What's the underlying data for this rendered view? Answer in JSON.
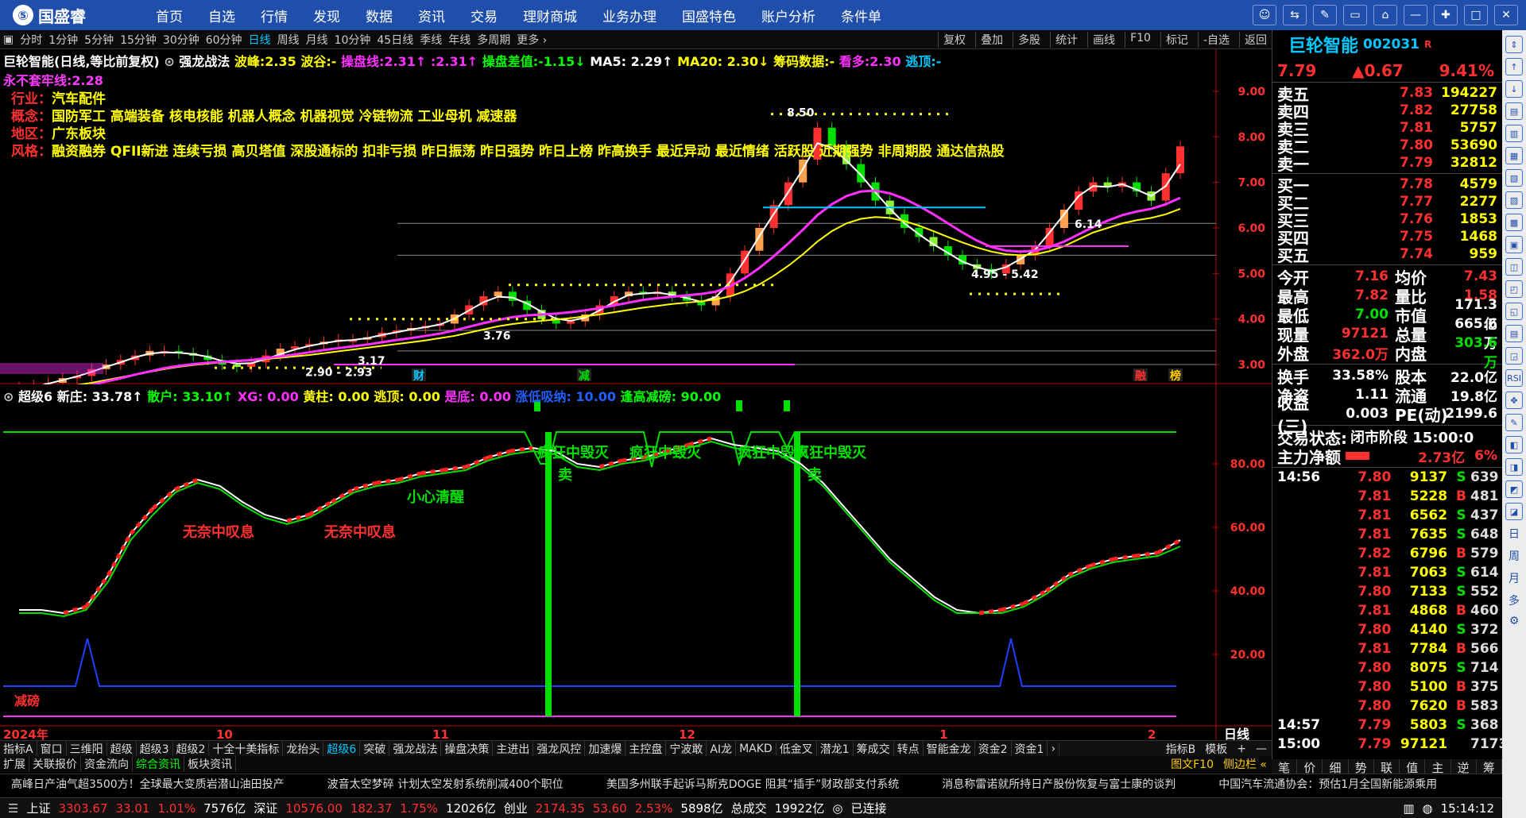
{
  "app": {
    "logo_glyph": "⑤",
    "name": "国盛睿",
    "nav": [
      "首页",
      "自选",
      "行情",
      "发现",
      "数据",
      "资讯",
      "交易",
      "理财商城",
      "业务办理",
      "国盛特色",
      "账户分析",
      "条件单"
    ],
    "window_controls": [
      "☺",
      "⇆",
      "✎",
      "▭",
      "⌂",
      "—",
      "✚",
      "□",
      "✕"
    ]
  },
  "periods": [
    "分时",
    "1分钟",
    "5分钟",
    "15分钟",
    "30分钟",
    "60分钟",
    "日线",
    "周线",
    "月线",
    "10分钟",
    "45日线",
    "季线",
    "年线",
    "多周期",
    "更多 ›"
  ],
  "active_period": "日线",
  "period_right": [
    "复权",
    "叠加",
    "多股",
    "统计",
    "画线",
    "F10",
    "标记",
    "-自选",
    "返回"
  ],
  "header": {
    "stock": "巨轮智能",
    "mode": "(日线,等比前复权)",
    "strategy": "强龙战法",
    "peak": "波峰:2.35",
    "valley": "波谷:-",
    "control_line": "操盘线:2.31↑ :2.31↑",
    "control_diff": "操盘差值:-1.15↓",
    "ma5": "MA5: 2.29↑",
    "ma20": "MA20: 2.30↓",
    "chips": "筹码数据:-",
    "longshort": "看多:2.30",
    "escape": "逃顶:-",
    "line2": "永不套牢线:2.28"
  },
  "tags": [
    {
      "label": "行业：",
      "value": "汽车配件"
    },
    {
      "label": "概念：",
      "value": "国防军工 高端装备 核电核能 机器人概念 机器视觉 冷链物流 工业母机 减速器"
    },
    {
      "label": "地区：",
      "value": "广东板块"
    },
    {
      "label": "风格：",
      "value": "融资融券 QFII新进 连续亏损 高贝塔值 深股通标的 扣非亏损 昨日振荡 昨日强势 昨日上榜 昨高换手 最近异动 最近情绪 活跃股 近期强势 非周期股 通达信热股"
    }
  ],
  "main_labels": {
    "high": "8.50",
    "low_a": "2.90 - 2.93",
    "low_b": "3.17",
    "mid": "3.76",
    "range1": "4.95 - 5.42",
    "range2": "6.14",
    "event_cai": "财",
    "event_jian": "减",
    "event_rong": "融",
    "event_bang": "榜"
  },
  "sub_header": {
    "name": "超级6",
    "xinzhuang": "新庄: 33.78↑",
    "sanhu": "散户: 33.10↑",
    "xg": "XG: 0.00",
    "huangzhu": "黄柱: 0.00",
    "taoding": "逃顶: 0.00",
    "shidi": "是底: 0.00",
    "zhangdi": "涨低吸纳: 10.00",
    "fengao": "逢高减磅: 90.00"
  },
  "sub_labels": {
    "wn1": "无奈中叹息",
    "wn2": "无奈中叹息",
    "xx": "小心清醒",
    "hm1": "疯狂中毁灭",
    "hm2": "疯狂中毁灭",
    "hm3": "疯狂中毁灭",
    "hm4": "疯狂中毁灭",
    "sell1": "卖",
    "sell2": "卖",
    "jianbang": "减磅"
  },
  "chart_data": [
    {
      "type": "line",
      "title": "",
      "ylim": [
        2.6,
        9.4
      ],
      "y_ticks": [
        "9.00",
        "8.00",
        "7.00",
        "6.00",
        "5.00",
        "4.00",
        "3.00"
      ],
      "x_ticks": [
        "2024年",
        "10",
        "11",
        "12",
        "1",
        "2"
      ],
      "bottom_right_label": "日线",
      "candles_close": [
        2.5,
        2.55,
        2.6,
        2.7,
        2.75,
        2.9,
        3.0,
        3.1,
        3.2,
        3.3,
        3.3,
        3.25,
        3.2,
        3.1,
        3.0,
        2.95,
        3.05,
        3.2,
        3.35,
        3.4,
        3.45,
        3.5,
        3.55,
        3.55,
        3.6,
        3.7,
        3.75,
        3.8,
        3.85,
        3.9,
        4.1,
        4.3,
        4.5,
        4.6,
        4.4,
        4.2,
        4.0,
        3.9,
        3.95,
        4.1,
        4.3,
        4.5,
        4.6,
        4.55,
        4.6,
        4.5,
        4.4,
        4.3,
        4.5,
        5.0,
        5.5,
        6.0,
        6.5,
        7.0,
        7.5,
        8.2,
        7.8,
        7.4,
        7.0,
        6.6,
        6.3,
        6.0,
        5.8,
        5.6,
        5.4,
        5.2,
        5.1,
        5.0,
        5.2,
        5.4,
        5.6,
        6.0,
        6.4,
        6.8,
        7.0,
        6.9,
        7.0,
        6.8,
        6.6,
        7.2,
        7.79
      ],
      "series": [
        {
          "name": "MA5",
          "values": [
            2.45,
            2.5,
            2.58,
            2.66,
            2.74,
            2.84,
            2.95,
            3.05,
            3.16,
            3.24,
            3.27,
            3.26,
            3.23,
            3.17,
            3.08,
            3.02,
            3.03,
            3.12,
            3.23,
            3.33,
            3.41,
            3.47,
            3.52,
            3.54,
            3.58,
            3.65,
            3.71,
            3.77,
            3.82,
            3.88,
            4.01,
            4.19,
            4.37,
            4.49,
            4.47,
            4.34,
            4.16,
            4.01,
            3.96,
            4.03,
            4.19,
            4.38,
            4.53,
            4.56,
            4.58,
            4.53,
            4.46,
            4.38,
            4.48,
            4.82,
            5.3,
            5.82,
            6.31,
            6.79,
            7.29,
            7.86,
            7.76,
            7.48,
            7.16,
            6.78,
            6.42,
            6.1,
            5.86,
            5.64,
            5.45,
            5.26,
            5.14,
            5.05,
            5.14,
            5.32,
            5.52,
            5.9,
            6.3,
            6.7,
            6.92,
            6.9,
            6.96,
            6.84,
            6.7,
            6.92,
            7.4
          ]
        },
        {
          "name": "MA20",
          "values": [
            2.4,
            2.43,
            2.46,
            2.5,
            2.55,
            2.6,
            2.66,
            2.72,
            2.78,
            2.84,
            2.9,
            2.95,
            2.99,
            3.02,
            3.05,
            3.07,
            3.09,
            3.12,
            3.15,
            3.18,
            3.21,
            3.25,
            3.29,
            3.33,
            3.37,
            3.41,
            3.45,
            3.49,
            3.53,
            3.58,
            3.63,
            3.7,
            3.77,
            3.84,
            3.89,
            3.93,
            3.96,
            3.99,
            4.02,
            4.06,
            4.1,
            4.15,
            4.2,
            4.25,
            4.29,
            4.33,
            4.36,
            4.39,
            4.43,
            4.5,
            4.61,
            4.76,
            4.95,
            5.17,
            5.42,
            5.7,
            5.93,
            6.1,
            6.2,
            6.24,
            6.22,
            6.15,
            6.05,
            5.93,
            5.8,
            5.68,
            5.57,
            5.48,
            5.42,
            5.4,
            5.42,
            5.49,
            5.6,
            5.75,
            5.9,
            6.0,
            6.1,
            6.17,
            6.22,
            6.3,
            6.42
          ]
        },
        {
          "name": "操盘线",
          "values": [
            2.3,
            2.33,
            2.37,
            2.42,
            2.48,
            2.55,
            2.63,
            2.7,
            2.78,
            2.85,
            2.92,
            2.97,
            3.01,
            3.04,
            3.06,
            3.08,
            3.1,
            3.14,
            3.18,
            3.22,
            3.27,
            3.32,
            3.36,
            3.4,
            3.44,
            3.49,
            3.54,
            3.58,
            3.63,
            3.68,
            3.75,
            3.83,
            3.91,
            3.98,
            4.04,
            4.08,
            4.1,
            4.12,
            4.15,
            4.19,
            4.24,
            4.3,
            4.36,
            4.42,
            4.46,
            4.49,
            4.52,
            4.55,
            4.6,
            4.72,
            4.9,
            5.12,
            5.38,
            5.66,
            5.96,
            6.28,
            6.52,
            6.7,
            6.8,
            6.82,
            6.76,
            6.64,
            6.48,
            6.3,
            6.1,
            5.9,
            5.72,
            5.58,
            5.5,
            5.48,
            5.5,
            5.58,
            5.7,
            5.86,
            6.02,
            6.16,
            6.28,
            6.36,
            6.42,
            6.52,
            6.66
          ]
        }
      ]
    },
    {
      "type": "line",
      "title": "",
      "ylim": [
        0,
        100
      ],
      "y_ticks": [
        "80.00",
        "60.00",
        "40.00",
        "20.00"
      ],
      "series": [
        {
          "name": "新庄",
          "values": [
            34,
            34,
            33,
            35,
            45,
            58,
            66,
            72,
            75,
            73,
            68,
            64,
            62,
            64,
            68,
            72,
            74,
            75,
            77,
            78,
            79,
            82,
            84,
            85,
            84,
            80,
            79,
            81,
            82,
            84,
            86,
            88,
            86,
            85,
            84,
            80,
            74,
            66,
            58,
            50,
            44,
            38,
            34,
            33,
            34,
            36,
            40,
            45,
            48,
            50,
            51,
            52,
            56
          ]
        },
        {
          "name": "散户",
          "values": [
            33,
            33,
            32,
            34,
            43,
            56,
            64,
            71,
            74,
            72,
            67,
            63,
            61,
            63,
            67,
            71,
            73,
            74,
            76,
            77,
            78,
            81,
            83,
            84,
            83,
            79,
            78,
            80,
            81,
            83,
            85,
            87,
            85,
            84,
            83,
            79,
            73,
            65,
            57,
            49,
            43,
            37,
            33,
            33,
            33,
            35,
            39,
            44,
            47,
            49,
            50,
            51,
            54
          ]
        }
      ]
    }
  ],
  "indicator_tabs": [
    "指标A",
    "窗口",
    "三维阳",
    "超级",
    "超级3",
    "超级2",
    "十全十美指标",
    "龙抬头",
    "超级6",
    "突破",
    "强龙战法",
    "操盘决策",
    "主进出",
    "强龙风控",
    "加速爆",
    "主控盘",
    "宁波敢",
    "AI龙",
    "MAKD",
    "低金叉",
    "潜龙1",
    "筹成交",
    "转点",
    "智能金龙",
    "资金2",
    "资金1",
    "›"
  ],
  "active_indicator": "超级6",
  "indicator_right": [
    "指标B",
    "模板",
    "+",
    "—"
  ],
  "ext_tabs": [
    "扩展",
    "关联报价",
    "资金流向",
    "综合资讯",
    "板块资讯"
  ],
  "active_ext": "综合资讯",
  "ext_right": [
    "图文F10",
    "侧边栏 «"
  ],
  "news": [
    "高峰日产油气超3500方！全球最大变质岩潜山油田投产",
    "波音太空梦碎 计划太空发射系统削减400个职位",
    "美国多州联手起诉马斯克DOGE 阻其“插手”财政部支付系统",
    "消息称雷诺就所持日产股份恢复与富士康的谈判",
    "中国汽车流通协会：预估1月全国新能源乘用"
  ],
  "status": {
    "sh_label": "上证",
    "sh_val": "3303.67",
    "sh_chg": "33.01",
    "sh_pct": "1.01%",
    "sh_amt": "7576亿",
    "sz_label": "深证",
    "sz_val": "10576.00",
    "sz_chg": "182.37",
    "sz_pct": "1.75%",
    "sz_amt": "12026亿",
    "cy_label": "创业",
    "cy_val": "2174.35",
    "cy_chg": "53.60",
    "cy_pct": "2.53%",
    "cy_amt": "5898亿",
    "total_label": "总成交",
    "total_val": "19922亿",
    "conn": "已连接",
    "time": "15:14:12"
  },
  "quote": {
    "name": "巨轮智能",
    "code": "002031",
    "r": "R",
    "price": "7.79",
    "change": "▲0.67",
    "pct": "9.41%",
    "sells": [
      {
        "l": "卖五",
        "p": "7.83",
        "v": "194227"
      },
      {
        "l": "卖四",
        "p": "7.82",
        "v": "27758"
      },
      {
        "l": "卖三",
        "p": "7.81",
        "v": "5757"
      },
      {
        "l": "卖二",
        "p": "7.80",
        "v": "53690"
      },
      {
        "l": "卖一",
        "p": "7.79",
        "v": "32812"
      }
    ],
    "buys": [
      {
        "l": "买一",
        "p": "7.78",
        "v": "4579"
      },
      {
        "l": "买二",
        "p": "7.77",
        "v": "2277"
      },
      {
        "l": "买三",
        "p": "7.76",
        "v": "1853"
      },
      {
        "l": "买四",
        "p": "7.75",
        "v": "1468"
      },
      {
        "l": "买五",
        "p": "7.74",
        "v": "959"
      }
    ],
    "stats": [
      [
        "今开",
        "7.16",
        "均价",
        "7.43"
      ],
      [
        "最高",
        "7.82",
        "量比",
        "1.58"
      ],
      [
        "最低",
        "7.00",
        "市值",
        "171.3亿"
      ],
      [
        "现量",
        "97121",
        "总量",
        "665.6万"
      ],
      [
        "外盘",
        "362.0万",
        "内盘",
        "303.6万"
      ]
    ],
    "stats2": [
      [
        "换手",
        "33.58%",
        "股本",
        "22.0亿"
      ],
      [
        "净资",
        "1.11",
        "流通",
        "19.8亿"
      ],
      [
        "收益(三)",
        "0.003",
        "PE(动)",
        "2199.6"
      ]
    ],
    "trade_status_label": "交易状态:",
    "trade_status": "闭市阶段 15:00:0",
    "net_label": "主力净额",
    "net_val": "2.73亿",
    "net_pct": "6%",
    "ticks": [
      {
        "t": "14:56",
        "p": "7.80",
        "v": "9137",
        "d": "S",
        "n": "639"
      },
      {
        "t": "",
        "p": "7.81",
        "v": "5228",
        "d": "B",
        "n": "481"
      },
      {
        "t": "",
        "p": "7.81",
        "v": "6562",
        "d": "S",
        "n": "437"
      },
      {
        "t": "",
        "p": "7.81",
        "v": "7635",
        "d": "S",
        "n": "648"
      },
      {
        "t": "",
        "p": "7.82",
        "v": "6796",
        "d": "B",
        "n": "579"
      },
      {
        "t": "",
        "p": "7.81",
        "v": "7063",
        "d": "S",
        "n": "614"
      },
      {
        "t": "",
        "p": "7.80",
        "v": "7133",
        "d": "S",
        "n": "552"
      },
      {
        "t": "",
        "p": "7.81",
        "v": "4868",
        "d": "B",
        "n": "460"
      },
      {
        "t": "",
        "p": "7.80",
        "v": "4140",
        "d": "S",
        "n": "372"
      },
      {
        "t": "",
        "p": "7.81",
        "v": "7784",
        "d": "B",
        "n": "566"
      },
      {
        "t": "",
        "p": "7.80",
        "v": "8075",
        "d": "S",
        "n": "714"
      },
      {
        "t": "",
        "p": "7.80",
        "v": "5100",
        "d": "B",
        "n": "375"
      },
      {
        "t": "",
        "p": "7.80",
        "v": "7620",
        "d": "B",
        "n": "583"
      },
      {
        "t": "14:57",
        "p": "7.79",
        "v": "5803",
        "d": "S",
        "n": "368"
      },
      {
        "t": "15:00",
        "p": "7.79",
        "v": "97121",
        "d": "",
        "n": "7173"
      }
    ],
    "tabs": [
      "笔",
      "价",
      "细",
      "势",
      "联",
      "值",
      "主",
      "逆",
      "筹"
    ]
  },
  "sidebar": [
    "⇕",
    "↑",
    "↓",
    "▤",
    "▥",
    "▦",
    "▧",
    "▨",
    "▩",
    "▣",
    "◫",
    "◰",
    "◱",
    "▤",
    "◲",
    "RSI",
    "✥",
    "✎",
    "◧",
    "◨",
    "◩",
    "◪"
  ],
  "sidebar_text": [
    "日",
    "周",
    "月",
    "多",
    "⚙"
  ],
  "colors": {
    "up": "#ff3030",
    "down": "#00e000",
    "ma5": "#ffffff",
    "ma20": "#ffff00",
    "control": "#ff30ff",
    "accent": "#00c8ff",
    "nav": "#1f4eab"
  }
}
